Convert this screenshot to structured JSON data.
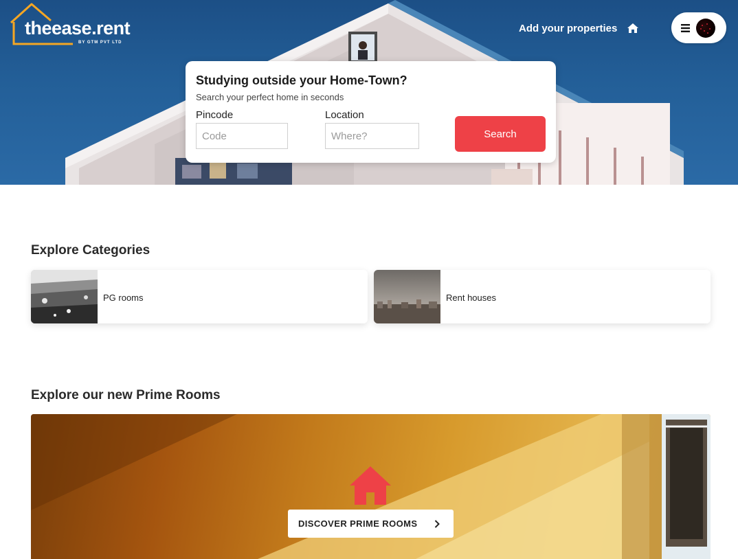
{
  "brand": {
    "name": "theease.rent",
    "tagline": "BY GTM PVT LTD"
  },
  "header": {
    "add_properties_label": "Add your properties",
    "add_properties_icon": "home-icon",
    "menu_icon": "hamburger-menu-icon"
  },
  "search": {
    "title": "Studying outside your Home-Town?",
    "subtitle": "Search your perfect home in seconds",
    "pincode_label": "Pincode",
    "pincode_placeholder": "Code",
    "location_label": "Location",
    "location_placeholder": "Where?",
    "button_label": "Search"
  },
  "categories": {
    "title": "Explore Categories",
    "items": [
      {
        "label": "PG rooms"
      },
      {
        "label": "Rent houses"
      }
    ]
  },
  "prime": {
    "title": "Explore our new Prime Rooms",
    "button_label": "DISCOVER PRIME ROOMS",
    "icon": "home-icon"
  },
  "colors": {
    "accent": "#ee4147",
    "logo_orange": "#f5a623",
    "hero_blue": "#235f98"
  }
}
